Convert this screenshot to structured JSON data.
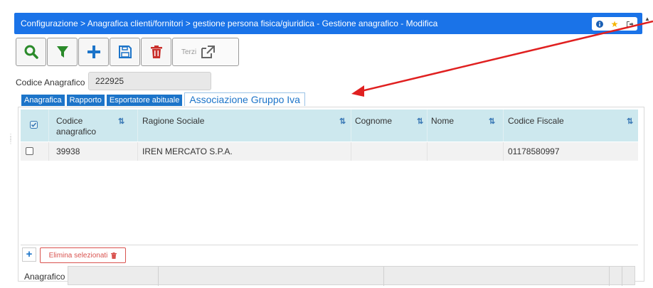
{
  "titlebar": {
    "title": "Configurazione > Anagrafica clienti/fornitori > gestione persona fisica/giuridica - Gestione anagrafico - Modifica"
  },
  "toolbar": {
    "terzi_label": "Terzi"
  },
  "codice": {
    "label": "Codice Anagrafico",
    "value": "222925"
  },
  "tabs": [
    {
      "label": "Anagrafica"
    },
    {
      "label": "Rapporto"
    },
    {
      "label": "Esportatore abituale"
    },
    {
      "label": "Associazione Gruppo Iva"
    }
  ],
  "table": {
    "columns": [
      {
        "label": "Codice anagrafico"
      },
      {
        "label": "Ragione Sociale"
      },
      {
        "label": "Cognome"
      },
      {
        "label": "Nome"
      },
      {
        "label": "Codice Fiscale"
      }
    ],
    "rows": [
      {
        "codice": "39938",
        "ragione_sociale": "IREN MERCATO S.P.A.",
        "cognome": "",
        "nome": "",
        "codice_fiscale": "01178580997"
      }
    ]
  },
  "actions": {
    "delete_label": "Elimina selezionati"
  },
  "footer": {
    "anagrafico_label": "Anagrafico"
  },
  "colors": {
    "titlebar": "#1a73e8",
    "tab_active": "#1c74c9",
    "table_header": "#cde8ee",
    "annotation_arrow": "#e02020"
  }
}
